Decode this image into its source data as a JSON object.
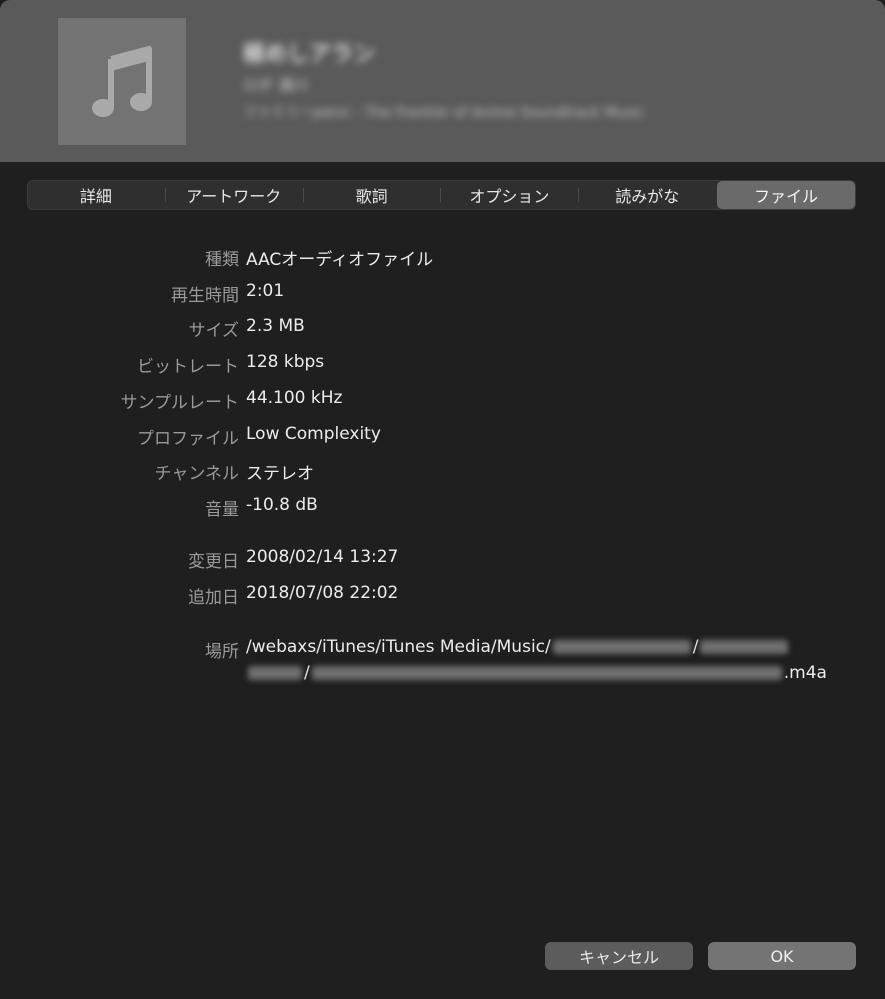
{
  "header": {
    "artwork_icon": "music-note-icon",
    "title": "極めしアラン",
    "subtitle": "ロボ 浦川",
    "album": "ファミリーpanic - The Frontier of Anime Soundtrack Music"
  },
  "tabs": [
    {
      "label": "詳細",
      "active": false
    },
    {
      "label": "アートワーク",
      "active": false
    },
    {
      "label": "歌詞",
      "active": false
    },
    {
      "label": "オプション",
      "active": false
    },
    {
      "label": "読みがな",
      "active": false
    },
    {
      "label": "ファイル",
      "active": true
    }
  ],
  "file_info": {
    "kind": {
      "label": "種類",
      "value": "AACオーディオファイル"
    },
    "duration": {
      "label": "再生時間",
      "value": "2:01"
    },
    "size": {
      "label": "サイズ",
      "value": "2.3 MB"
    },
    "bitrate": {
      "label": "ビットレート",
      "value": "128 kbps"
    },
    "sample_rate": {
      "label": "サンプルレート",
      "value": "44.100 kHz"
    },
    "profile": {
      "label": "プロファイル",
      "value": "Low Complexity"
    },
    "channels": {
      "label": "チャンネル",
      "value": "ステレオ"
    },
    "volume": {
      "label": "音量",
      "value": "-10.8 dB"
    },
    "modified": {
      "label": "変更日",
      "value": "2008/02/14 13:27"
    },
    "added": {
      "label": "追加日",
      "value": "2018/07/08 22:02"
    },
    "location": {
      "label": "場所",
      "path_prefix": "/webaxs/iTunes/iTunes Media/Music/",
      "sep": "/",
      "extension": ".m4a"
    }
  },
  "buttons": {
    "cancel": "キャンセル",
    "ok": "OK"
  },
  "colors": {
    "background": "#1f1f1f",
    "header": "#5a5a5a",
    "active_tab": "#6a6a6a"
  }
}
